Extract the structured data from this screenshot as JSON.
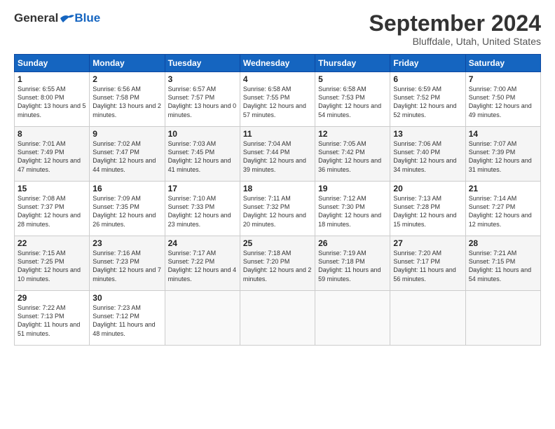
{
  "header": {
    "logo_general": "General",
    "logo_blue": "Blue",
    "month_title": "September 2024",
    "location": "Bluffdale, Utah, United States"
  },
  "weekdays": [
    "Sunday",
    "Monday",
    "Tuesday",
    "Wednesday",
    "Thursday",
    "Friday",
    "Saturday"
  ],
  "weeks": [
    [
      {
        "day": "1",
        "sunrise": "6:55 AM",
        "sunset": "8:00 PM",
        "daylight": "13 hours and 5 minutes."
      },
      {
        "day": "2",
        "sunrise": "6:56 AM",
        "sunset": "7:58 PM",
        "daylight": "13 hours and 2 minutes."
      },
      {
        "day": "3",
        "sunrise": "6:57 AM",
        "sunset": "7:57 PM",
        "daylight": "13 hours and 0 minutes."
      },
      {
        "day": "4",
        "sunrise": "6:58 AM",
        "sunset": "7:55 PM",
        "daylight": "12 hours and 57 minutes."
      },
      {
        "day": "5",
        "sunrise": "6:58 AM",
        "sunset": "7:53 PM",
        "daylight": "12 hours and 54 minutes."
      },
      {
        "day": "6",
        "sunrise": "6:59 AM",
        "sunset": "7:52 PM",
        "daylight": "12 hours and 52 minutes."
      },
      {
        "day": "7",
        "sunrise": "7:00 AM",
        "sunset": "7:50 PM",
        "daylight": "12 hours and 49 minutes."
      }
    ],
    [
      {
        "day": "8",
        "sunrise": "7:01 AM",
        "sunset": "7:49 PM",
        "daylight": "12 hours and 47 minutes."
      },
      {
        "day": "9",
        "sunrise": "7:02 AM",
        "sunset": "7:47 PM",
        "daylight": "12 hours and 44 minutes."
      },
      {
        "day": "10",
        "sunrise": "7:03 AM",
        "sunset": "7:45 PM",
        "daylight": "12 hours and 41 minutes."
      },
      {
        "day": "11",
        "sunrise": "7:04 AM",
        "sunset": "7:44 PM",
        "daylight": "12 hours and 39 minutes."
      },
      {
        "day": "12",
        "sunrise": "7:05 AM",
        "sunset": "7:42 PM",
        "daylight": "12 hours and 36 minutes."
      },
      {
        "day": "13",
        "sunrise": "7:06 AM",
        "sunset": "7:40 PM",
        "daylight": "12 hours and 34 minutes."
      },
      {
        "day": "14",
        "sunrise": "7:07 AM",
        "sunset": "7:39 PM",
        "daylight": "12 hours and 31 minutes."
      }
    ],
    [
      {
        "day": "15",
        "sunrise": "7:08 AM",
        "sunset": "7:37 PM",
        "daylight": "12 hours and 28 minutes."
      },
      {
        "day": "16",
        "sunrise": "7:09 AM",
        "sunset": "7:35 PM",
        "daylight": "12 hours and 26 minutes."
      },
      {
        "day": "17",
        "sunrise": "7:10 AM",
        "sunset": "7:33 PM",
        "daylight": "12 hours and 23 minutes."
      },
      {
        "day": "18",
        "sunrise": "7:11 AM",
        "sunset": "7:32 PM",
        "daylight": "12 hours and 20 minutes."
      },
      {
        "day": "19",
        "sunrise": "7:12 AM",
        "sunset": "7:30 PM",
        "daylight": "12 hours and 18 minutes."
      },
      {
        "day": "20",
        "sunrise": "7:13 AM",
        "sunset": "7:28 PM",
        "daylight": "12 hours and 15 minutes."
      },
      {
        "day": "21",
        "sunrise": "7:14 AM",
        "sunset": "7:27 PM",
        "daylight": "12 hours and 12 minutes."
      }
    ],
    [
      {
        "day": "22",
        "sunrise": "7:15 AM",
        "sunset": "7:25 PM",
        "daylight": "12 hours and 10 minutes."
      },
      {
        "day": "23",
        "sunrise": "7:16 AM",
        "sunset": "7:23 PM",
        "daylight": "12 hours and 7 minutes."
      },
      {
        "day": "24",
        "sunrise": "7:17 AM",
        "sunset": "7:22 PM",
        "daylight": "12 hours and 4 minutes."
      },
      {
        "day": "25",
        "sunrise": "7:18 AM",
        "sunset": "7:20 PM",
        "daylight": "12 hours and 2 minutes."
      },
      {
        "day": "26",
        "sunrise": "7:19 AM",
        "sunset": "7:18 PM",
        "daylight": "11 hours and 59 minutes."
      },
      {
        "day": "27",
        "sunrise": "7:20 AM",
        "sunset": "7:17 PM",
        "daylight": "11 hours and 56 minutes."
      },
      {
        "day": "28",
        "sunrise": "7:21 AM",
        "sunset": "7:15 PM",
        "daylight": "11 hours and 54 minutes."
      }
    ],
    [
      {
        "day": "29",
        "sunrise": "7:22 AM",
        "sunset": "7:13 PM",
        "daylight": "11 hours and 51 minutes."
      },
      {
        "day": "30",
        "sunrise": "7:23 AM",
        "sunset": "7:12 PM",
        "daylight": "11 hours and 48 minutes."
      },
      null,
      null,
      null,
      null,
      null
    ]
  ]
}
